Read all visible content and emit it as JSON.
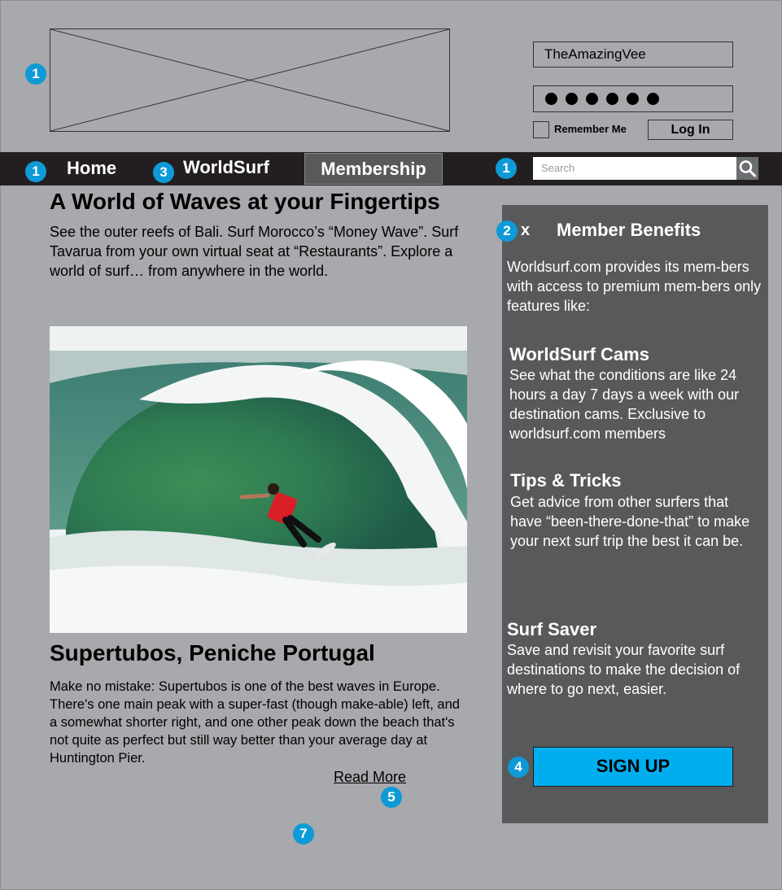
{
  "header": {
    "username_value": "TheAmazingVee",
    "password_dot_count": 6,
    "remember_label": "Remember Me",
    "login_label": "Log In"
  },
  "nav": {
    "items": [
      {
        "label": "Home"
      },
      {
        "label": "WorldSurf"
      },
      {
        "label": "Membership",
        "active": true
      }
    ],
    "search_placeholder": "Search"
  },
  "annotations": {
    "logo": "1",
    "nav_home": "1",
    "nav_worldsurf": "3",
    "search": "1",
    "sidebar_close": "2",
    "signup": "4",
    "read_more": "5",
    "page_bottom": "7"
  },
  "main": {
    "headline": "A World of Waves at your Fingertips",
    "intro": "See the outer reefs of Bali. Surf Morocco’s “Money Wave”. Surf Tavarua from your own virtual seat at “Restaurants”. Explore a world of surf… from anywhere in the world.",
    "article_title": "Supertubos, Peniche Portugal",
    "article_body": "Make no mistake: Supertubos is one of the best waves in Europe. There's one main peak with a super-fast (though make-able) left, and a somewhat shorter right, and one other peak down the beach that's not quite as perfect but still way better than your average day at Huntington Pier.",
    "read_more": "Read More"
  },
  "sidebar": {
    "close_label": "x",
    "title": "Member Benefits",
    "intro": "Worldsurf.com provides its mem-bers with access to premium mem-bers only features like:",
    "features": [
      {
        "title": "WorldSurf Cams",
        "text": "See what the conditions are like 24 hours a day 7 days a week with our destination cams. Exclusive to worldsurf.com members"
      },
      {
        "title": "Tips & Tricks",
        "text": "Get advice from other surfers that have “been-there-done-that” to make your next surf trip the best it can be."
      },
      {
        "title": "Surf Saver",
        "text": "Save and revisit your favorite surf destinations to make the decision of where to go next, easier."
      }
    ],
    "signup_label": "SIGN UP"
  },
  "colors": {
    "page_bg": "#a7a9ac",
    "nav_bg": "#231f20",
    "sidebar_bg": "#58595b",
    "accent": "#00aeef",
    "badge": "#0e9ad7"
  }
}
